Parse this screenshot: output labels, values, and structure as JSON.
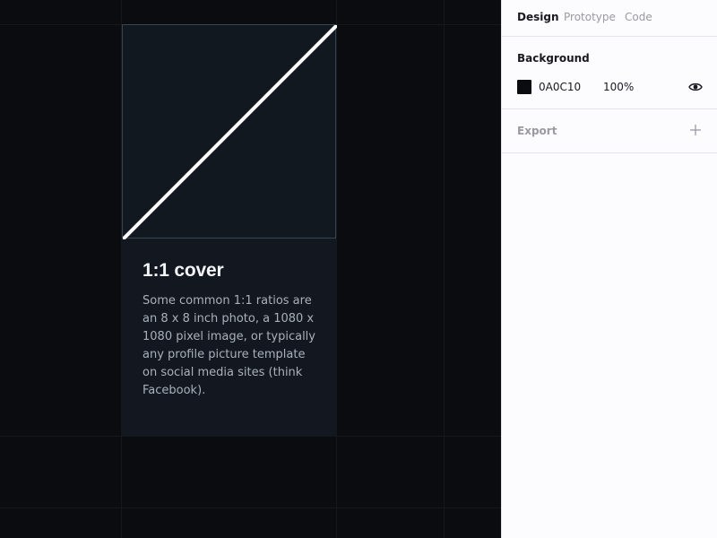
{
  "canvas": {
    "background": "#0a0c10",
    "card": {
      "title": "1:1 cover",
      "body": "Some common 1:1 ratios are an 8 x 8 inch photo, a 1080 x 1080 pixel image, or typically any profile picture template on social media sites (think Facebook)."
    }
  },
  "panel": {
    "tabs": [
      {
        "label": "Design",
        "active": true
      },
      {
        "label": "Prototype",
        "active": false
      },
      {
        "label": "Code",
        "active": false
      }
    ],
    "background": {
      "title": "Background",
      "hex": "0A0C10",
      "opacity": "100%",
      "swatch_color": "#0a0c10",
      "visibility_icon": "eye-icon"
    },
    "export": {
      "title": "Export",
      "add_icon": "plus-icon"
    }
  }
}
